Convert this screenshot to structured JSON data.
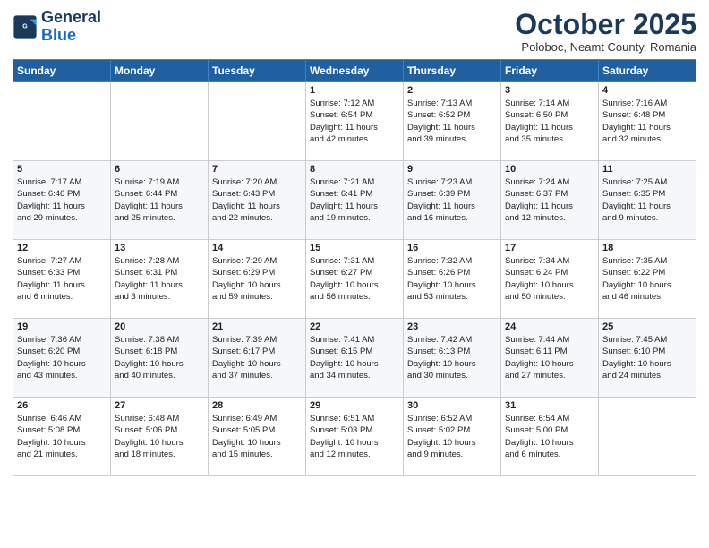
{
  "header": {
    "logo_general": "General",
    "logo_blue": "Blue",
    "month": "October 2025",
    "location": "Poloboc, Neamt County, Romania"
  },
  "weekdays": [
    "Sunday",
    "Monday",
    "Tuesday",
    "Wednesday",
    "Thursday",
    "Friday",
    "Saturday"
  ],
  "weeks": [
    [
      {
        "day": "",
        "info": ""
      },
      {
        "day": "",
        "info": ""
      },
      {
        "day": "",
        "info": ""
      },
      {
        "day": "1",
        "info": "Sunrise: 7:12 AM\nSunset: 6:54 PM\nDaylight: 11 hours\nand 42 minutes."
      },
      {
        "day": "2",
        "info": "Sunrise: 7:13 AM\nSunset: 6:52 PM\nDaylight: 11 hours\nand 39 minutes."
      },
      {
        "day": "3",
        "info": "Sunrise: 7:14 AM\nSunset: 6:50 PM\nDaylight: 11 hours\nand 35 minutes."
      },
      {
        "day": "4",
        "info": "Sunrise: 7:16 AM\nSunset: 6:48 PM\nDaylight: 11 hours\nand 32 minutes."
      }
    ],
    [
      {
        "day": "5",
        "info": "Sunrise: 7:17 AM\nSunset: 6:46 PM\nDaylight: 11 hours\nand 29 minutes."
      },
      {
        "day": "6",
        "info": "Sunrise: 7:19 AM\nSunset: 6:44 PM\nDaylight: 11 hours\nand 25 minutes."
      },
      {
        "day": "7",
        "info": "Sunrise: 7:20 AM\nSunset: 6:43 PM\nDaylight: 11 hours\nand 22 minutes."
      },
      {
        "day": "8",
        "info": "Sunrise: 7:21 AM\nSunset: 6:41 PM\nDaylight: 11 hours\nand 19 minutes."
      },
      {
        "day": "9",
        "info": "Sunrise: 7:23 AM\nSunset: 6:39 PM\nDaylight: 11 hours\nand 16 minutes."
      },
      {
        "day": "10",
        "info": "Sunrise: 7:24 AM\nSunset: 6:37 PM\nDaylight: 11 hours\nand 12 minutes."
      },
      {
        "day": "11",
        "info": "Sunrise: 7:25 AM\nSunset: 6:35 PM\nDaylight: 11 hours\nand 9 minutes."
      }
    ],
    [
      {
        "day": "12",
        "info": "Sunrise: 7:27 AM\nSunset: 6:33 PM\nDaylight: 11 hours\nand 6 minutes."
      },
      {
        "day": "13",
        "info": "Sunrise: 7:28 AM\nSunset: 6:31 PM\nDaylight: 11 hours\nand 3 minutes."
      },
      {
        "day": "14",
        "info": "Sunrise: 7:29 AM\nSunset: 6:29 PM\nDaylight: 10 hours\nand 59 minutes."
      },
      {
        "day": "15",
        "info": "Sunrise: 7:31 AM\nSunset: 6:27 PM\nDaylight: 10 hours\nand 56 minutes."
      },
      {
        "day": "16",
        "info": "Sunrise: 7:32 AM\nSunset: 6:26 PM\nDaylight: 10 hours\nand 53 minutes."
      },
      {
        "day": "17",
        "info": "Sunrise: 7:34 AM\nSunset: 6:24 PM\nDaylight: 10 hours\nand 50 minutes."
      },
      {
        "day": "18",
        "info": "Sunrise: 7:35 AM\nSunset: 6:22 PM\nDaylight: 10 hours\nand 46 minutes."
      }
    ],
    [
      {
        "day": "19",
        "info": "Sunrise: 7:36 AM\nSunset: 6:20 PM\nDaylight: 10 hours\nand 43 minutes."
      },
      {
        "day": "20",
        "info": "Sunrise: 7:38 AM\nSunset: 6:18 PM\nDaylight: 10 hours\nand 40 minutes."
      },
      {
        "day": "21",
        "info": "Sunrise: 7:39 AM\nSunset: 6:17 PM\nDaylight: 10 hours\nand 37 minutes."
      },
      {
        "day": "22",
        "info": "Sunrise: 7:41 AM\nSunset: 6:15 PM\nDaylight: 10 hours\nand 34 minutes."
      },
      {
        "day": "23",
        "info": "Sunrise: 7:42 AM\nSunset: 6:13 PM\nDaylight: 10 hours\nand 30 minutes."
      },
      {
        "day": "24",
        "info": "Sunrise: 7:44 AM\nSunset: 6:11 PM\nDaylight: 10 hours\nand 27 minutes."
      },
      {
        "day": "25",
        "info": "Sunrise: 7:45 AM\nSunset: 6:10 PM\nDaylight: 10 hours\nand 24 minutes."
      }
    ],
    [
      {
        "day": "26",
        "info": "Sunrise: 6:46 AM\nSunset: 5:08 PM\nDaylight: 10 hours\nand 21 minutes."
      },
      {
        "day": "27",
        "info": "Sunrise: 6:48 AM\nSunset: 5:06 PM\nDaylight: 10 hours\nand 18 minutes."
      },
      {
        "day": "28",
        "info": "Sunrise: 6:49 AM\nSunset: 5:05 PM\nDaylight: 10 hours\nand 15 minutes."
      },
      {
        "day": "29",
        "info": "Sunrise: 6:51 AM\nSunset: 5:03 PM\nDaylight: 10 hours\nand 12 minutes."
      },
      {
        "day": "30",
        "info": "Sunrise: 6:52 AM\nSunset: 5:02 PM\nDaylight: 10 hours\nand 9 minutes."
      },
      {
        "day": "31",
        "info": "Sunrise: 6:54 AM\nSunset: 5:00 PM\nDaylight: 10 hours\nand 6 minutes."
      },
      {
        "day": "",
        "info": ""
      }
    ]
  ]
}
